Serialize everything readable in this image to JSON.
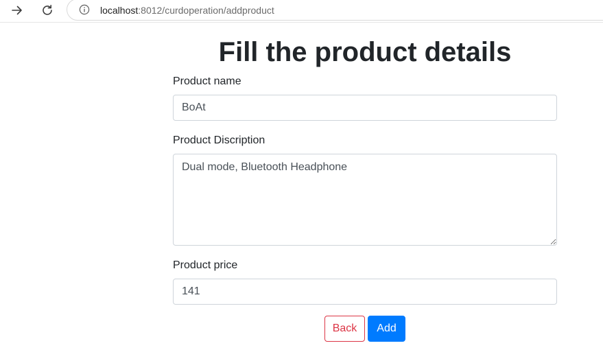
{
  "browser": {
    "url_host": "localhost",
    "url_rest": ":8012/curdoperation/addproduct"
  },
  "form": {
    "title": "Fill the product details",
    "name_label": "Product name",
    "name_value": "BoAt",
    "description_label": "Product Discription",
    "description_value": "Dual mode, Bluetooth Headphone",
    "price_label": "Product price",
    "price_value": "141",
    "back_label": "Back",
    "add_label": "Add"
  },
  "colors": {
    "primary": "#007bff",
    "danger": "#dc3545",
    "text": "#212529",
    "input_border": "#ced4da"
  },
  "icons": {
    "forward": "forward-arrow-icon",
    "reload": "reload-icon",
    "site_info": "info-icon"
  }
}
